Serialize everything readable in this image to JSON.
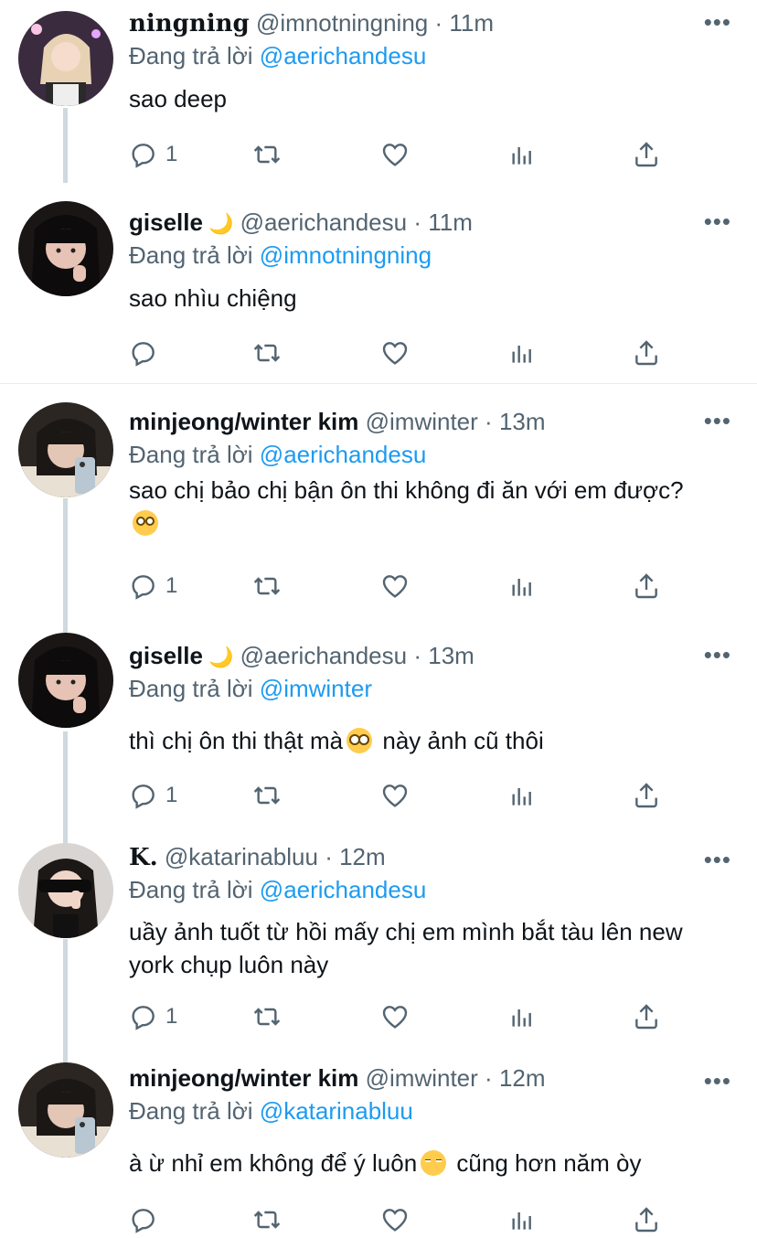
{
  "tweets": [
    {
      "display_name": "ningning",
      "handle": "@imnotningning",
      "time": "11m",
      "replying_label": "Đang trả lời",
      "replying_to": "@aerichandesu",
      "text": "sao deep",
      "replies": "1",
      "moon": ""
    },
    {
      "display_name": "giselle",
      "handle": "@aerichandesu",
      "time": "11m",
      "replying_label": "Đang trả lời",
      "replying_to": "@imnotningning",
      "text": "sao nhìu chiệng",
      "replies": "",
      "moon": "🌙"
    },
    {
      "display_name": "minjeong/winter kim",
      "handle": "@imwinter",
      "time": "13m",
      "replying_label": "Đang trả lời",
      "replying_to": "@aerichandesu",
      "text_before": "sao chị bảo chị bận ôn thi không đi ăn với em được?",
      "text_after": "",
      "replies": "1",
      "emoji": "eye-roll-emoji"
    },
    {
      "display_name": "giselle",
      "handle": "@aerichandesu",
      "time": "13m",
      "replying_label": "Đang trả lời",
      "replying_to": "@imwinter",
      "text_before": "thì chị ôn thi thật mà",
      "text_after": "này ảnh cũ thôi",
      "replies": "1",
      "moon": "🌙",
      "emoji": "pleading-face-emoji"
    },
    {
      "display_name": "K.",
      "handle": "@katarinabluu",
      "time": "12m",
      "replying_label": "Đang trả lời",
      "replying_to": "@aerichandesu",
      "text": "uầy ảnh tuốt từ hồi mấy chị em mình bắt tàu lên new york chụp luôn này",
      "replies": "1"
    },
    {
      "display_name": "minjeong/winter kim",
      "handle": "@imwinter",
      "time": "12m",
      "replying_label": "Đang trả lời",
      "replying_to": "@katarinabluu",
      "text_before": "à ừ nhỉ em không để ý luôn",
      "text_after": "cũng hơn năm òy",
      "replies": "",
      "emoji": "pensive-face-emoji"
    }
  ],
  "separator": "·",
  "icons": [
    "reply-icon",
    "retweet-icon",
    "like-icon",
    "analytics-icon",
    "share-icon",
    "more-icon"
  ],
  "colors": {
    "link": "#1d9bf0",
    "muted": "#536471",
    "thread_line": "#cfd9de"
  }
}
